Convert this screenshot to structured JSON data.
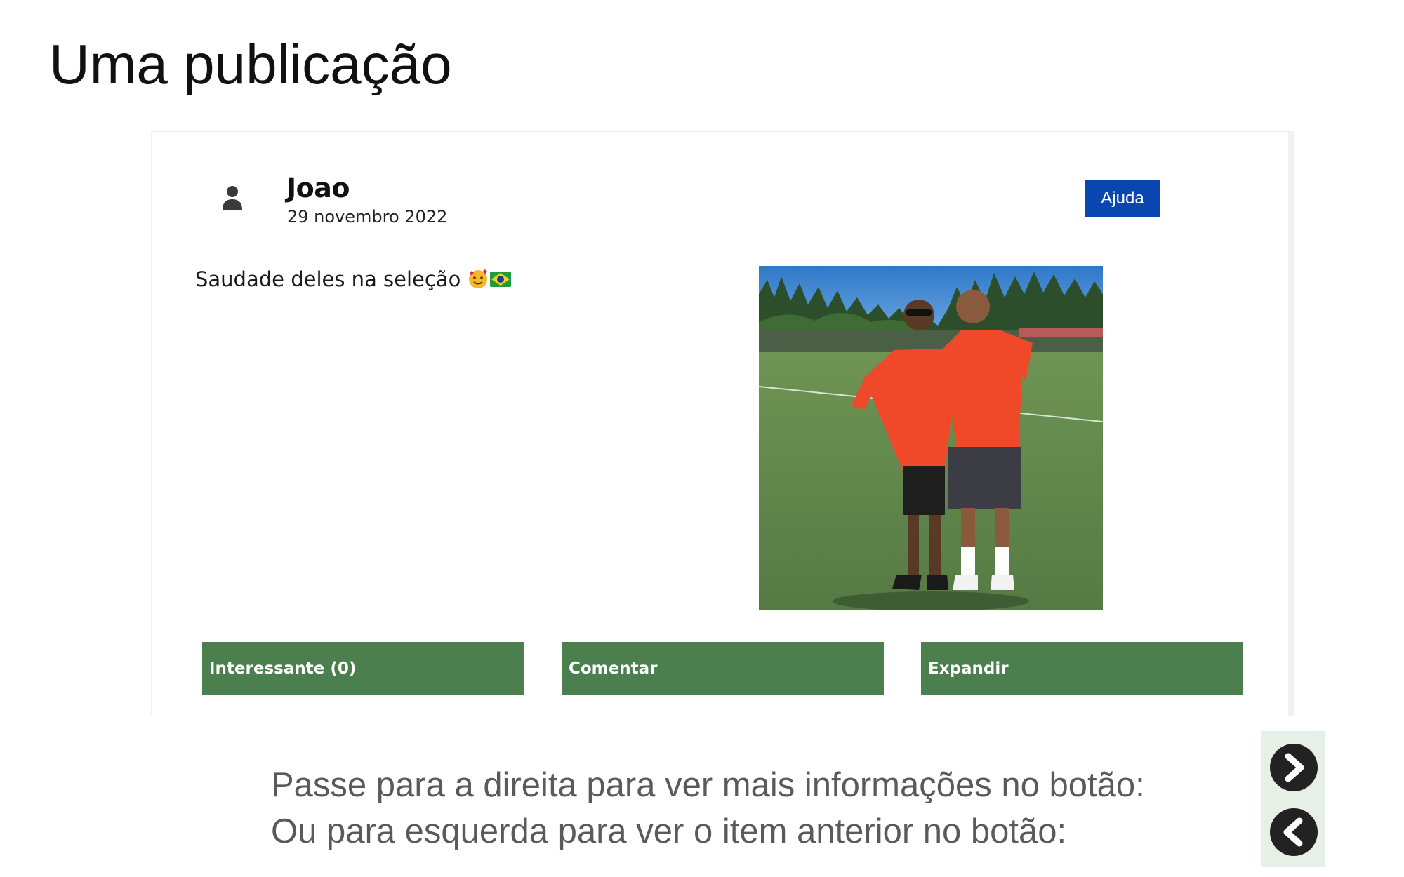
{
  "page": {
    "title": "Uma publicação"
  },
  "post": {
    "author": "Joao",
    "date": "29 novembro 2022",
    "help_label": "Ajuda",
    "text": "Saudade deles na seleção",
    "emojis": [
      "smiling-face-with-hearts-emoji",
      "brazil-flag-emoji"
    ],
    "image_description_icon": "photo-two-players-red-shirts-field",
    "actions": [
      {
        "label": "Interessante (0)"
      },
      {
        "label": "Comentar"
      },
      {
        "label": "Expandir"
      }
    ]
  },
  "instructions": {
    "line1": "Passe para a direita para ver mais informações no botão:",
    "line2": "Ou para esquerda para ver o item anterior no botão:"
  },
  "navigation": {
    "next_icon": "chevron-right-icon",
    "prev_icon": "chevron-left-icon"
  },
  "colors": {
    "help_button": "#0a46b2",
    "action_button": "#4b7f4e",
    "nav_panel": "#e7f0e7"
  }
}
